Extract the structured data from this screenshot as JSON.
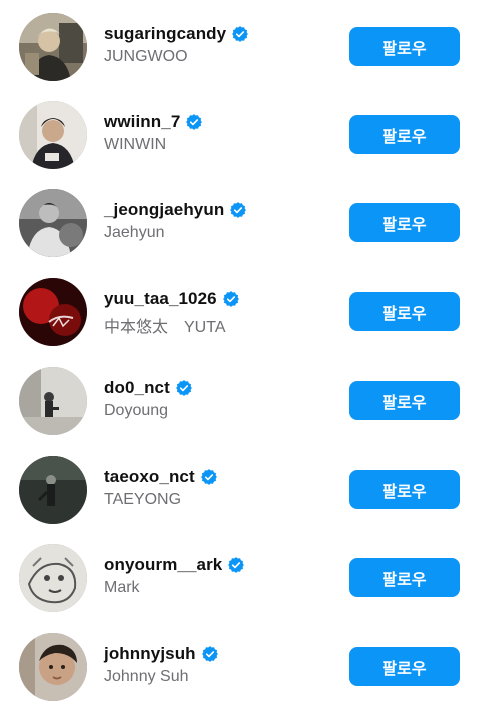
{
  "accounts": [
    {
      "username": "sugaringcandy",
      "name": "JUNGWOO",
      "follow_label": "팔로우",
      "verified": true,
      "avatar": "profile-photo"
    },
    {
      "username": "wwiinn_7",
      "name": "WINWIN",
      "follow_label": "팔로우",
      "verified": true,
      "avatar": "profile-photo"
    },
    {
      "username": "_jeongjaehyun",
      "name": "Jaehyun",
      "follow_label": "팔로우",
      "verified": true,
      "avatar": "profile-photo"
    },
    {
      "username": "yuu_taa_1026",
      "name": "中本悠太　YUTA",
      "follow_label": "팔로우",
      "verified": true,
      "avatar": "profile-photo"
    },
    {
      "username": "do0_nct",
      "name": "Doyoung",
      "follow_label": "팔로우",
      "verified": true,
      "avatar": "profile-photo"
    },
    {
      "username": "taeoxo_nct",
      "name": "TAEYONG",
      "follow_label": "팔로우",
      "verified": true,
      "avatar": "profile-photo"
    },
    {
      "username": "onyourm__ark",
      "name": "Mark",
      "follow_label": "팔로우",
      "verified": true,
      "avatar": "profile-photo"
    },
    {
      "username": "johnnyjsuh",
      "name": "Johnny Suh",
      "follow_label": "팔로우",
      "verified": true,
      "avatar": "profile-photo"
    }
  ],
  "colors": {
    "follow_button": "#0b95f6",
    "verified_badge": "#0b95f6",
    "username_text": "#111111",
    "name_text": "#6e6e73"
  },
  "icons": {
    "verified": "verified-badge-icon"
  }
}
